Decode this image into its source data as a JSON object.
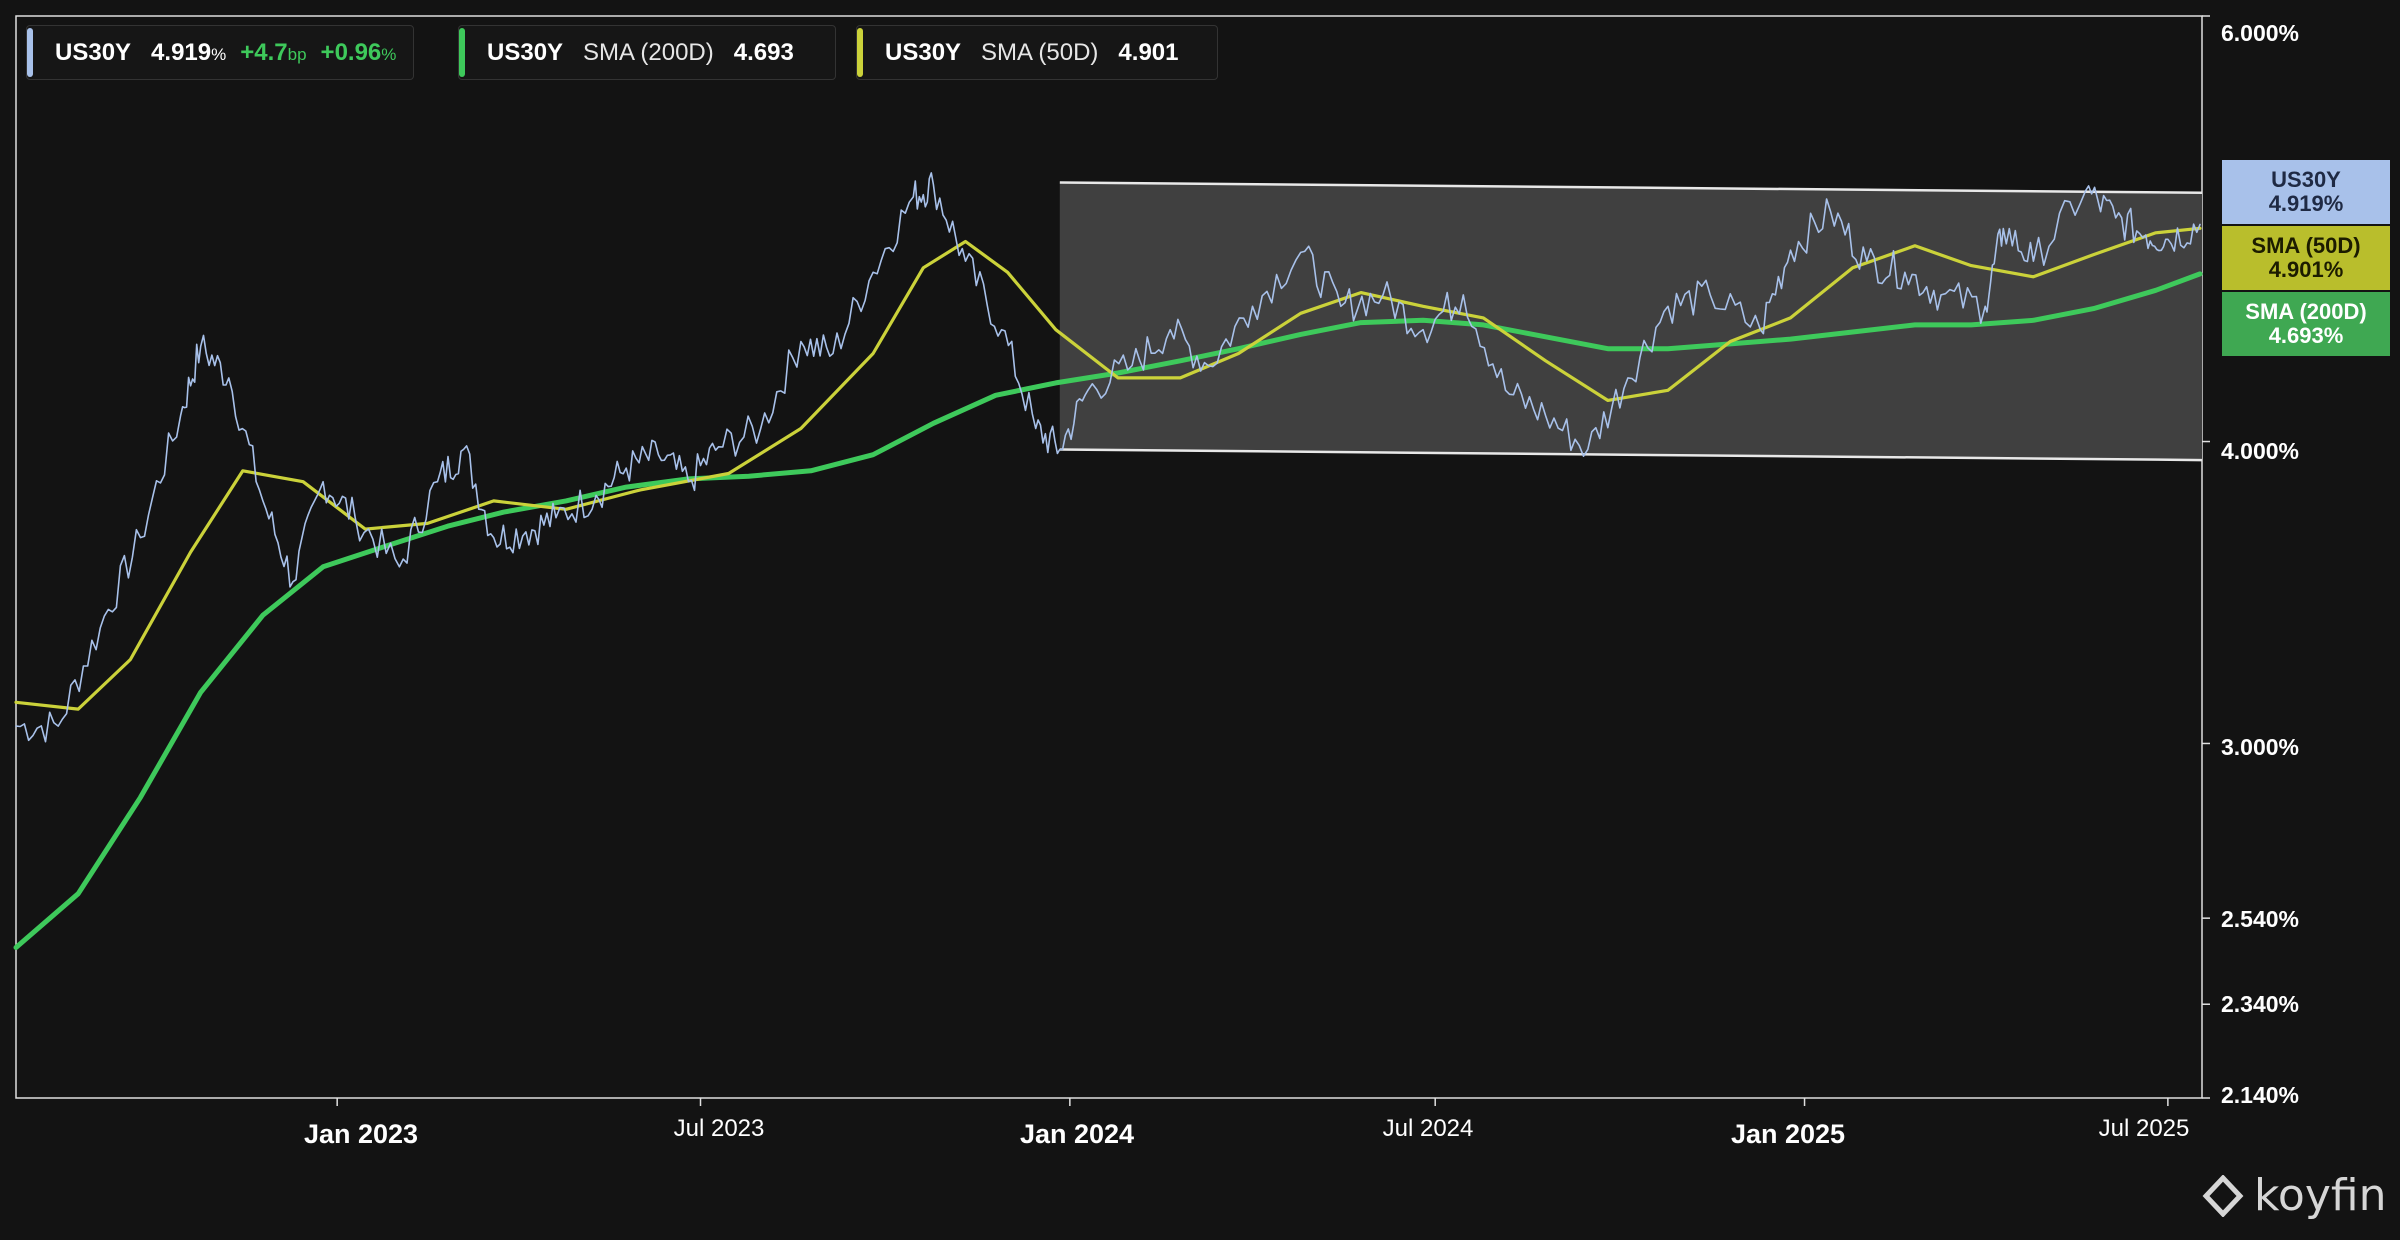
{
  "chart_data": {
    "type": "line",
    "y_scale": "log",
    "ylim": [
      2.14,
      6.0
    ],
    "xlim": [
      "2022-07-25",
      "2025-07-18"
    ],
    "y_ticks": [
      "6.000%",
      "4.000%",
      "3.000%",
      "2.540%",
      "2.340%",
      "2.140%"
    ],
    "y_tick_values": [
      6.0,
      4.0,
      3.0,
      2.54,
      2.34,
      2.14
    ],
    "x_ticks": [
      {
        "label": "Jan 2023",
        "date": "2023-01-01",
        "major": true
      },
      {
        "label": "Jul 2023",
        "date": "2023-07-01",
        "major": false
      },
      {
        "label": "Jan 2024",
        "date": "2024-01-01",
        "major": true
      },
      {
        "label": "Jul 2024",
        "date": "2024-07-01",
        "major": false
      },
      {
        "label": "Jan 2025",
        "date": "2025-01-01",
        "major": true
      },
      {
        "label": "Jul 2025",
        "date": "2025-07-01",
        "major": false
      }
    ],
    "series": [
      {
        "name": "US30Y",
        "color": "#a8c1ea",
        "points": [
          [
            "2022-07-25",
            3.05
          ],
          [
            "2022-08-15",
            3.05
          ],
          [
            "2022-09-05",
            3.35
          ],
          [
            "2022-09-25",
            3.65
          ],
          [
            "2022-10-15",
            4.1
          ],
          [
            "2022-10-25",
            4.38
          ],
          [
            "2022-11-08",
            4.25
          ],
          [
            "2022-11-25",
            3.78
          ],
          [
            "2022-12-10",
            3.5
          ],
          [
            "2022-12-25",
            3.85
          ],
          [
            "2023-01-10",
            3.72
          ],
          [
            "2023-02-01",
            3.55
          ],
          [
            "2023-02-20",
            3.85
          ],
          [
            "2023-03-05",
            3.97
          ],
          [
            "2023-03-20",
            3.65
          ],
          [
            "2023-04-05",
            3.67
          ],
          [
            "2023-04-20",
            3.72
          ],
          [
            "2023-05-10",
            3.8
          ],
          [
            "2023-05-25",
            3.9
          ],
          [
            "2023-06-10",
            3.95
          ],
          [
            "2023-06-25",
            3.85
          ],
          [
            "2023-07-10",
            3.98
          ],
          [
            "2023-07-31",
            4.05
          ],
          [
            "2023-08-20",
            4.4
          ],
          [
            "2023-09-05",
            4.35
          ],
          [
            "2023-09-25",
            4.7
          ],
          [
            "2023-10-15",
            5.05
          ],
          [
            "2023-10-25",
            5.11
          ],
          [
            "2023-11-10",
            4.75
          ],
          [
            "2023-11-28",
            4.45
          ],
          [
            "2023-12-15",
            4.05
          ],
          [
            "2023-12-27",
            3.97
          ],
          [
            "2024-01-10",
            4.2
          ],
          [
            "2024-02-01",
            4.3
          ],
          [
            "2024-02-20",
            4.45
          ],
          [
            "2024-03-10",
            4.3
          ],
          [
            "2024-04-01",
            4.55
          ],
          [
            "2024-04-25",
            4.79
          ],
          [
            "2024-05-15",
            4.55
          ],
          [
            "2024-06-05",
            4.6
          ],
          [
            "2024-06-25",
            4.45
          ],
          [
            "2024-07-15",
            4.6
          ],
          [
            "2024-08-05",
            4.2
          ],
          [
            "2024-08-25",
            4.1
          ],
          [
            "2024-09-15",
            3.97
          ],
          [
            "2024-10-05",
            4.25
          ],
          [
            "2024-10-25",
            4.55
          ],
          [
            "2024-11-15",
            4.6
          ],
          [
            "2024-12-10",
            4.45
          ],
          [
            "2024-12-25",
            4.8
          ],
          [
            "2025-01-14",
            4.98
          ],
          [
            "2025-02-01",
            4.75
          ],
          [
            "2025-02-20",
            4.7
          ],
          [
            "2025-03-10",
            4.6
          ],
          [
            "2025-04-01",
            4.55
          ],
          [
            "2025-04-10",
            4.9
          ],
          [
            "2025-04-25",
            4.75
          ],
          [
            "2025-05-21",
            5.08
          ],
          [
            "2025-06-05",
            4.95
          ],
          [
            "2025-06-20",
            4.87
          ],
          [
            "2025-07-01",
            4.85
          ],
          [
            "2025-07-17",
            4.919
          ]
        ]
      },
      {
        "name": "SMA (50D)",
        "color": "#cbd23a",
        "points": [
          [
            "2022-07-25",
            3.12
          ],
          [
            "2022-08-25",
            3.1
          ],
          [
            "2022-09-20",
            3.25
          ],
          [
            "2022-10-20",
            3.6
          ],
          [
            "2022-11-15",
            3.89
          ],
          [
            "2022-12-15",
            3.85
          ],
          [
            "2023-01-15",
            3.68
          ],
          [
            "2023-02-15",
            3.7
          ],
          [
            "2023-03-20",
            3.78
          ],
          [
            "2023-04-25",
            3.75
          ],
          [
            "2023-06-01",
            3.82
          ],
          [
            "2023-07-15",
            3.88
          ],
          [
            "2023-08-20",
            4.05
          ],
          [
            "2023-09-25",
            4.35
          ],
          [
            "2023-10-20",
            4.72
          ],
          [
            "2023-11-10",
            4.84
          ],
          [
            "2023-12-01",
            4.7
          ],
          [
            "2023-12-25",
            4.45
          ],
          [
            "2024-01-25",
            4.25
          ],
          [
            "2024-02-25",
            4.25
          ],
          [
            "2024-03-25",
            4.35
          ],
          [
            "2024-04-25",
            4.52
          ],
          [
            "2024-05-25",
            4.61
          ],
          [
            "2024-06-25",
            4.55
          ],
          [
            "2024-07-25",
            4.5
          ],
          [
            "2024-08-25",
            4.32
          ],
          [
            "2024-09-25",
            4.16
          ],
          [
            "2024-10-25",
            4.2
          ],
          [
            "2024-11-25",
            4.4
          ],
          [
            "2024-12-25",
            4.5
          ],
          [
            "2025-01-25",
            4.72
          ],
          [
            "2025-02-25",
            4.82
          ],
          [
            "2025-03-25",
            4.73
          ],
          [
            "2025-04-25",
            4.68
          ],
          [
            "2025-05-25",
            4.78
          ],
          [
            "2025-06-25",
            4.88
          ],
          [
            "2025-07-17",
            4.901
          ]
        ]
      },
      {
        "name": "SMA (200D)",
        "color": "#3ec95b",
        "points": [
          [
            "2022-07-25",
            2.47
          ],
          [
            "2022-08-25",
            2.6
          ],
          [
            "2022-09-25",
            2.85
          ],
          [
            "2022-10-25",
            3.15
          ],
          [
            "2022-11-25",
            3.39
          ],
          [
            "2022-12-25",
            3.55
          ],
          [
            "2023-01-25",
            3.62
          ],
          [
            "2023-02-25",
            3.69
          ],
          [
            "2023-03-25",
            3.74
          ],
          [
            "2023-04-25",
            3.78
          ],
          [
            "2023-05-25",
            3.83
          ],
          [
            "2023-06-25",
            3.86
          ],
          [
            "2023-07-25",
            3.87
          ],
          [
            "2023-08-25",
            3.89
          ],
          [
            "2023-09-25",
            3.95
          ],
          [
            "2023-10-25",
            4.07
          ],
          [
            "2023-11-25",
            4.18
          ],
          [
            "2023-12-25",
            4.23
          ],
          [
            "2024-01-25",
            4.27
          ],
          [
            "2024-02-25",
            4.32
          ],
          [
            "2024-03-25",
            4.37
          ],
          [
            "2024-04-25",
            4.43
          ],
          [
            "2024-05-25",
            4.48
          ],
          [
            "2024-06-25",
            4.49
          ],
          [
            "2024-07-25",
            4.47
          ],
          [
            "2024-08-25",
            4.42
          ],
          [
            "2024-09-25",
            4.37
          ],
          [
            "2024-10-25",
            4.37
          ],
          [
            "2024-11-25",
            4.39
          ],
          [
            "2024-12-25",
            4.41
          ],
          [
            "2025-01-25",
            4.44
          ],
          [
            "2025-02-25",
            4.47
          ],
          [
            "2025-03-25",
            4.47
          ],
          [
            "2025-04-25",
            4.49
          ],
          [
            "2025-05-25",
            4.54
          ],
          [
            "2025-06-25",
            4.62
          ],
          [
            "2025-07-17",
            4.693
          ]
        ]
      }
    ],
    "annotations": [
      {
        "type": "channel",
        "upper": [
          [
            "2023-12-27",
            5.12
          ],
          [
            "2025-07-18",
            5.07
          ]
        ],
        "lower": [
          [
            "2023-12-27",
            3.97
          ],
          [
            "2025-07-18",
            3.93
          ]
        ]
      }
    ]
  },
  "legend": [
    {
      "ticker": "US30Y",
      "value": "4.919",
      "value_unit": "%",
      "change_bp": "+4.7",
      "change_bp_unit": "bp",
      "change_pct": "+0.96",
      "change_pct_unit": "%",
      "color": "#a8c1ea"
    },
    {
      "ticker": "US30Y",
      "label": "SMA (200D)",
      "value": "4.693",
      "color": "#3ec95b"
    },
    {
      "ticker": "US30Y",
      "label": "SMA (50D)",
      "value": "4.901",
      "color": "#cbd23a"
    }
  ],
  "price_tags": [
    {
      "name": "US30Y",
      "value": "4.919%",
      "bg": "#a8c1ea",
      "fg": "#1f2a44"
    },
    {
      "name": "SMA (50D)",
      "value": "4.901%",
      "bg": "#b9be2c",
      "fg": "#1c1c00"
    },
    {
      "name": "SMA (200D)",
      "value": "4.693%",
      "bg": "#3fa852",
      "fg": "#ffffff"
    }
  ],
  "brand": {
    "name": "koyfin"
  }
}
